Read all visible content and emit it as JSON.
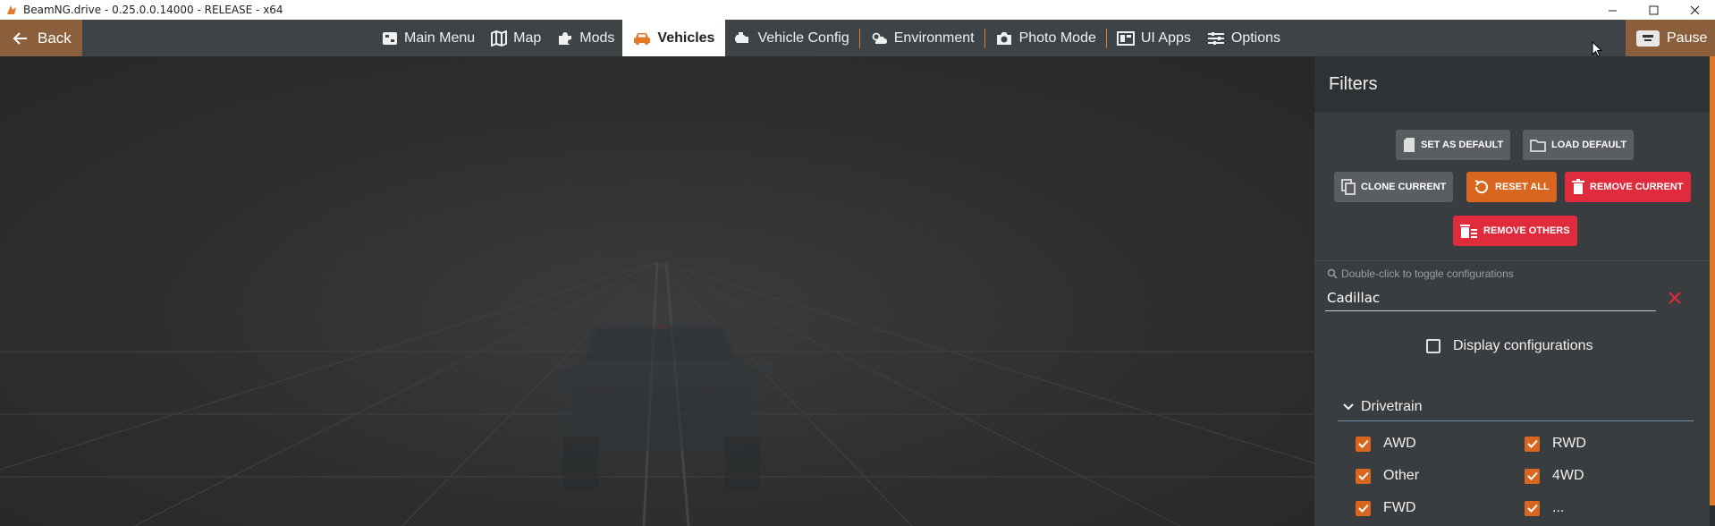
{
  "window": {
    "title": "BeamNG.drive - 0.25.0.0.14000 - RELEASE - x64",
    "controls": [
      "minimize",
      "maximize",
      "close"
    ]
  },
  "nav": {
    "back_label": "Back",
    "items": [
      {
        "label": "Main Menu",
        "icon": "main-menu-icon"
      },
      {
        "label": "Map",
        "icon": "map-icon"
      },
      {
        "label": "Mods",
        "icon": "puzzle-icon"
      },
      {
        "label": "Vehicles",
        "icon": "car-icon",
        "active": true
      },
      {
        "label": "Vehicle Config",
        "icon": "engine-icon"
      },
      {
        "label": "Environment",
        "icon": "weather-icon"
      },
      {
        "label": "Photo Mode",
        "icon": "camera-icon"
      },
      {
        "label": "UI Apps",
        "icon": "ui-apps-icon"
      },
      {
        "label": "Options",
        "icon": "sliders-icon"
      }
    ],
    "pause_label": "Pause"
  },
  "filters": {
    "title": "Filters",
    "buttons": {
      "set_default": "SET AS DEFAULT",
      "load_default": "LOAD DEFAULT",
      "clone_current": "CLONE CURRENT",
      "reset_all": "RESET ALL",
      "remove_current": "REMOVE CURRENT",
      "remove_others": "REMOVE OTHERS"
    },
    "search_hint": "Double-click to toggle configurations",
    "search_value": "Cadillac",
    "display_configurations": "Display configurations",
    "drivetrain": {
      "title": "Drivetrain",
      "options": [
        {
          "label": "AWD",
          "checked": true
        },
        {
          "label": "RWD",
          "checked": true
        },
        {
          "label": "Other",
          "checked": true
        },
        {
          "label": "4WD",
          "checked": true
        },
        {
          "label": "FWD",
          "checked": true
        },
        {
          "label": "...",
          "checked": true
        }
      ]
    }
  },
  "colors": {
    "accent": "#e3782a",
    "danger": "#e02b3c",
    "nav_bg": "#3e4347",
    "panel_bg": "#3a3d40"
  }
}
